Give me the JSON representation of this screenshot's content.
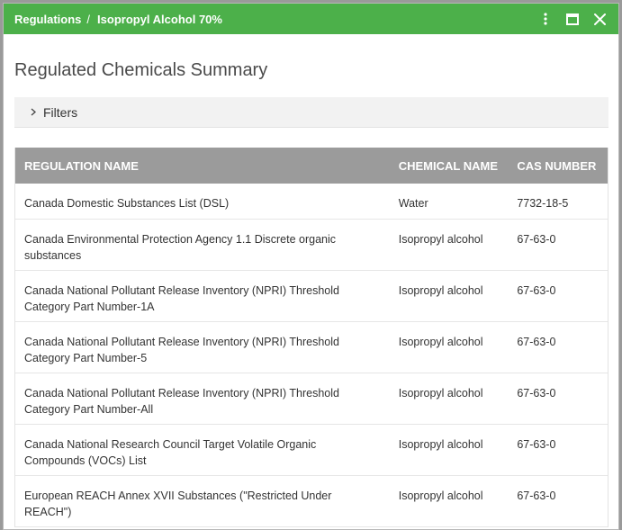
{
  "header": {
    "breadcrumb_root": "Regulations",
    "breadcrumb_sep": "/",
    "breadcrumb_current": "Isopropyl Alcohol 70%",
    "accent_color": "#4cb04a"
  },
  "icons": [
    "more-vertical-icon",
    "maximize-icon",
    "close-icon",
    "chevron-right-icon"
  ],
  "main": {
    "title": "Regulated Chemicals Summary",
    "filters_label": "Filters"
  },
  "table": {
    "headers": [
      "REGULATION NAME",
      "CHEMICAL NAME",
      "CAS NUMBER"
    ],
    "rows": [
      [
        "Canada Domestic Substances List (DSL)",
        "Water",
        "7732-18-5"
      ],
      [
        "Canada Environmental Protection Agency 1.1 Discrete organic substances",
        "Isopropyl alcohol",
        "67-63-0"
      ],
      [
        "Canada National Pollutant Release Inventory (NPRI) Threshold Category Part Number-1A",
        "Isopropyl alcohol",
        "67-63-0"
      ],
      [
        "Canada National Pollutant Release Inventory (NPRI) Threshold Category Part Number-5",
        "Isopropyl alcohol",
        "67-63-0"
      ],
      [
        "Canada National Pollutant Release Inventory (NPRI) Threshold Category Part Number-All",
        "Isopropyl alcohol",
        "67-63-0"
      ],
      [
        "Canada National Research Council Target Volatile Organic Compounds (VOCs) List",
        "Isopropyl alcohol",
        "67-63-0"
      ],
      [
        "European REACH Annex XVII Substances (\"Restricted Under REACH\")",
        "Isopropyl alcohol",
        "67-63-0"
      ]
    ]
  }
}
